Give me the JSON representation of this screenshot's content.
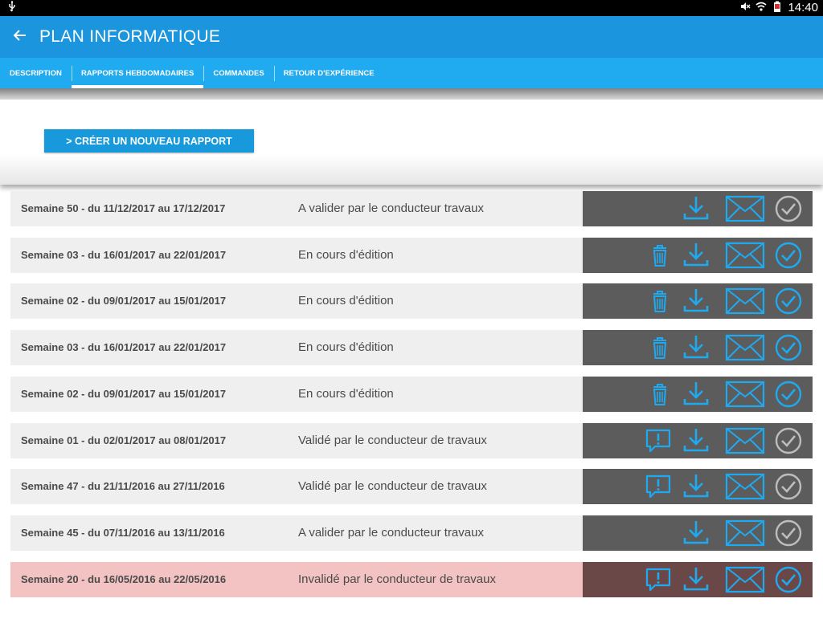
{
  "statusbar": {
    "time": "14:40",
    "icons": [
      "usb-icon",
      "mute-icon",
      "wifi-icon",
      "battery-icon"
    ]
  },
  "appbar": {
    "title": "PLAN INFORMATIQUE",
    "back_icon": "arrow-left-icon"
  },
  "tabs": [
    {
      "label": "DESCRIPTION",
      "active": false
    },
    {
      "label": "RAPPORTS HEBDOMADAIRES",
      "active": true
    },
    {
      "label": "COMMANDES",
      "active": false
    },
    {
      "label": "RETOUR D'EXPÉRIENCE",
      "active": false
    }
  ],
  "create_button": {
    "label": "> CRÉER UN NOUVEAU RAPPORT"
  },
  "colors": {
    "appbar": "#1b95de",
    "tabbar": "#20aaf0",
    "icon_blue": "#1eaaf1",
    "icon_grey": "#bdbdbd",
    "action_bg": "#5c5c5c",
    "invalid_row": "#f3c3c3"
  },
  "reports": [
    {
      "period": "Semaine 50 - du 11/12/2017 au 17/12/2017",
      "status": "A valider par le conducteur travaux",
      "left_icon": "",
      "check_active": false,
      "invalid": false
    },
    {
      "period": "Semaine 03 - du 16/01/2017 au 22/01/2017",
      "status": "En cours d'édition",
      "left_icon": "trash-icon",
      "check_active": true,
      "invalid": false
    },
    {
      "period": "Semaine 02 - du 09/01/2017 au 15/01/2017",
      "status": "En cours d'édition",
      "left_icon": "trash-icon",
      "check_active": true,
      "invalid": false
    },
    {
      "period": "Semaine 03 - du 16/01/2017 au 22/01/2017",
      "status": "En cours d'édition",
      "left_icon": "trash-icon",
      "check_active": true,
      "invalid": false
    },
    {
      "period": "Semaine 02 - du 09/01/2017 au 15/01/2017",
      "status": "En cours d'édition",
      "left_icon": "trash-icon",
      "check_active": true,
      "invalid": false
    },
    {
      "period": "Semaine 01 - du 02/01/2017 au 08/01/2017",
      "status": "Validé par le conducteur de travaux",
      "left_icon": "comment-alert-icon",
      "check_active": false,
      "invalid": false
    },
    {
      "period": "Semaine 47 - du 21/11/2016 au 27/11/2016",
      "status": "Validé par le conducteur de travaux",
      "left_icon": "comment-alert-icon",
      "check_active": false,
      "invalid": false
    },
    {
      "period": "Semaine 45 - du 07/11/2016 au 13/11/2016",
      "status": "A valider par le conducteur travaux",
      "left_icon": "",
      "check_active": false,
      "invalid": false
    },
    {
      "period": "Semaine 20 - du 16/05/2016 au 22/05/2016",
      "status": "Invalidé par le conducteur de travaux",
      "left_icon": "comment-alert-icon",
      "check_active": true,
      "invalid": true
    }
  ]
}
